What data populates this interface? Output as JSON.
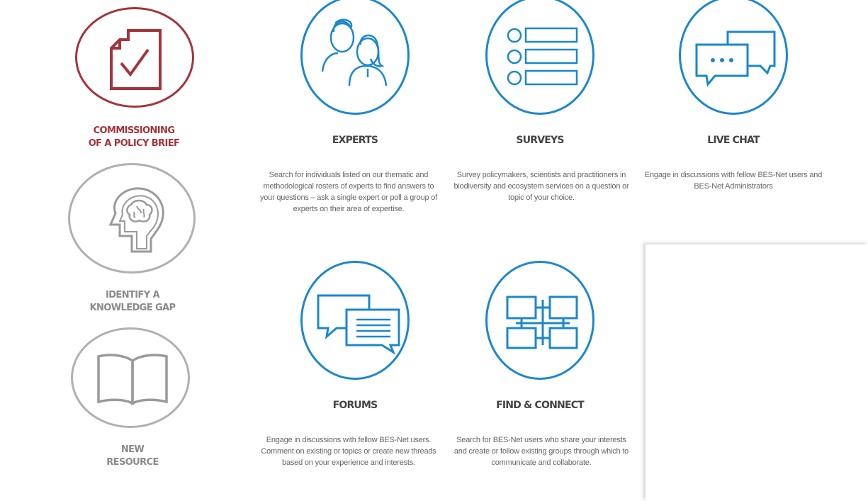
{
  "steps": [
    {
      "label": "COMMISSIONING\nOF A POLICY BRIEF",
      "icon": "document-check-icon",
      "color": "#a4343a"
    },
    {
      "label": "IDENTIFY A\nKNOWLEDGE GAP",
      "icon": "brain-head-icon",
      "color": "#9a9a9a"
    },
    {
      "label": "NEW\nRESOURCE",
      "icon": "open-book-icon",
      "color": "#9a9a9a"
    }
  ],
  "services": [
    {
      "title": "EXPERTS",
      "icon": "people-icon",
      "description": "Search for individuals listed on our thematic and methodological rosters of experts to find answers to your questions – ask a single expert or poll a group of experts on their area of expertise."
    },
    {
      "title": "SURVEYS",
      "icon": "list-icon",
      "description": "Survey policymakers, scientists and practitioners in biodiversity and ecosystem services on a question or topic of your choice."
    },
    {
      "title": "LIVE CHAT",
      "icon": "chat-bubbles-icon",
      "description": "Engage in discussions with fellow BES-Net users and BES-Net Administrators"
    },
    {
      "title": "FORUMS",
      "icon": "forum-bubbles-icon",
      "description": "Engage in discussions with fellow BES-Net users. Comment on existing or topics or create new threads based on your experience and interests."
    },
    {
      "title": "FIND & CONNECT",
      "icon": "network-grid-icon",
      "description": "Search for BES-Net users who share your interests and create or follow existing groups through which to communicate and collaborate."
    }
  ],
  "colors": {
    "accent_blue": "#1b87cc",
    "brief_red": "#a4343a",
    "muted_gray": "#9a9a9a"
  }
}
